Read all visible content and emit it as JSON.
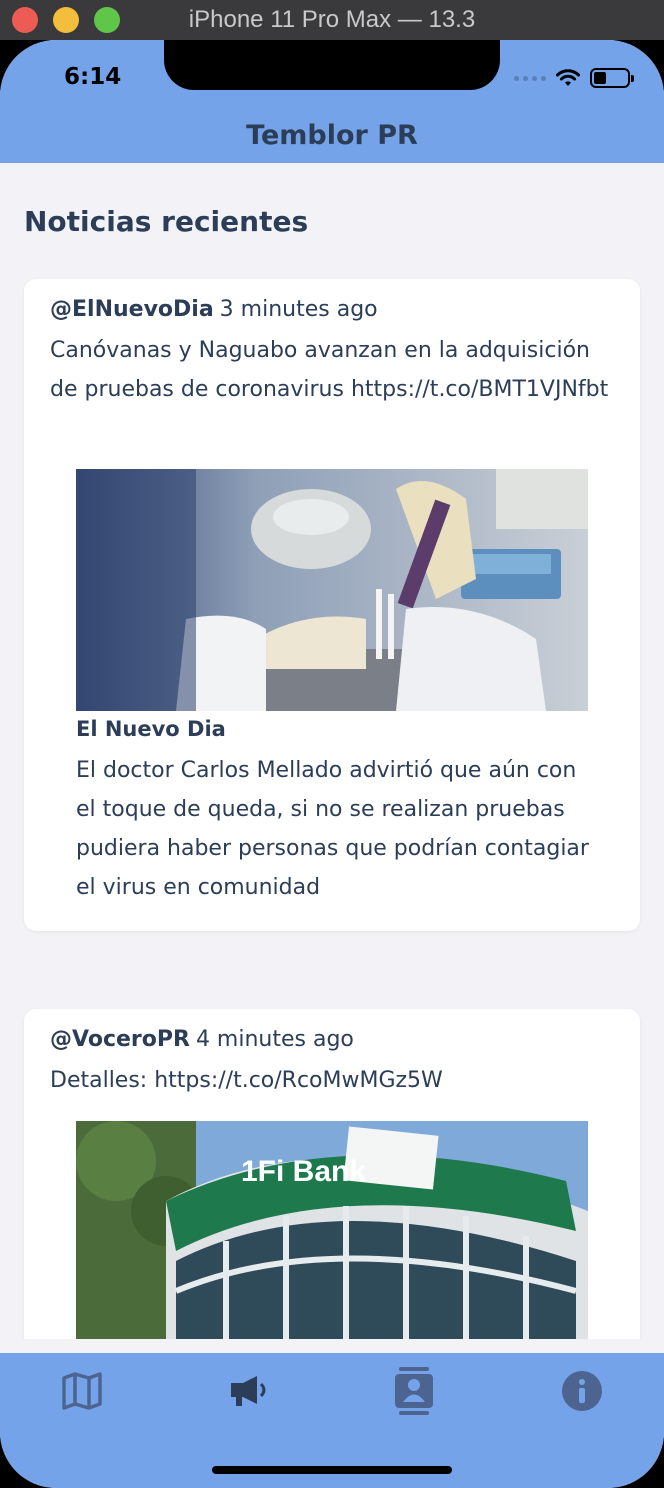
{
  "window": {
    "title": "iPhone 11 Pro Max — 13.3"
  },
  "status_bar": {
    "time": "6:14",
    "icons": [
      "cellular-dots-icon",
      "wifi-icon",
      "battery-icon"
    ]
  },
  "nav": {
    "title": "Temblor PR"
  },
  "section": {
    "title": "Noticias recientes"
  },
  "tweets": [
    {
      "handle": "@ElNuevoDia",
      "time_ago": "3 minutes ago",
      "text": "Canóvanas y Naguabo avanzan en la adquisición de pruebas de coronavirus https://t.co/BMT1VJNfbt",
      "preview": {
        "image": "lab-pipette-photo",
        "source": "El Nuevo Dia",
        "description": "El doctor Carlos Mellado advirtió que aún con el toque de queda, si no se realizan pruebas pudiera haber personas que podrían contagiar el virus en comunidad"
      }
    },
    {
      "handle": "@VoceroPR",
      "time_ago": "4 minutes ago",
      "text": "Detalles: https://t.co/RcoMwMGz5W",
      "preview": {
        "image": "bank-building-photo",
        "sign_text": "1Fi   Bank"
      }
    }
  ],
  "tabbar": {
    "items": [
      {
        "icon": "map-icon",
        "active": false
      },
      {
        "icon": "megaphone-icon",
        "active": true
      },
      {
        "icon": "contacts-icon",
        "active": false
      },
      {
        "icon": "info-icon",
        "active": false
      }
    ]
  },
  "colors": {
    "header": "#74a3ea",
    "text": "#2c3e57",
    "background": "#f2f2f7",
    "card": "#ffffff"
  }
}
